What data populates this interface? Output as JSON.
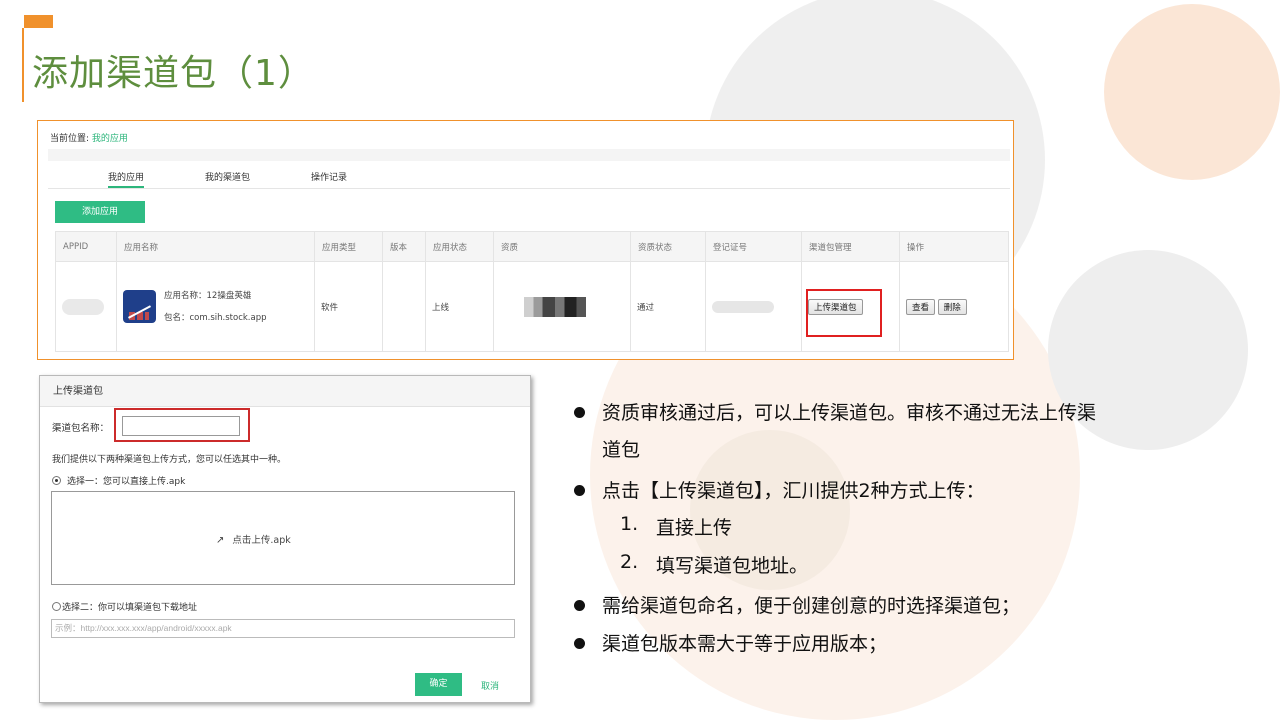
{
  "slide": {
    "title": "添加渠道包（1）",
    "accent_color": "#f0912c",
    "title_color": "#5e8e3e"
  },
  "top_screenshot": {
    "breadcrumb_label": "当前位置:",
    "breadcrumb_link": "我的应用",
    "tabs": [
      {
        "label": "我的应用",
        "active": true
      },
      {
        "label": "我的渠道包",
        "active": false
      },
      {
        "label": "操作记录",
        "active": false
      }
    ],
    "add_app_button": "添加应用",
    "columns": [
      "APPID",
      "应用名称",
      "应用类型",
      "版本",
      "应用状态",
      "资质",
      "资质状态",
      "登记证号",
      "渠道包管理",
      "操作"
    ],
    "row": {
      "app_name": "应用名称：12操盘英雄",
      "package": "包名：com.sih.stock.app",
      "type": "软件",
      "version": "",
      "status": "上线",
      "qualification_status": "通过",
      "upload_button": "上传渠道包",
      "view_button": "查看",
      "delete_button": "删除"
    },
    "brand_color": "#2fbc84",
    "highlight_color": "#e02020"
  },
  "dialog": {
    "title": "上传渠道包",
    "name_label": "渠道包名称：",
    "name_value": "",
    "intro": "我们提供以下两种渠道包上传方式，您可以任选其中一种。",
    "option1": "选择一：您可以直接上传.apk",
    "option1_selected": true,
    "upload_link": "点击上传.apk",
    "option2": "选择二：你可以填渠道包下载地址",
    "option2_selected": false,
    "url_placeholder": "示例：http://xxx.xxx.xxx/app/android/xxxxx.apk",
    "confirm_button": "确定",
    "cancel_link": "取消"
  },
  "bullets": {
    "b1_line1": "资质审核通过后，可以上传渠道包。审核不通过无法上传渠",
    "b1_line2": "道包",
    "b2": "点击【上传渠道包】，汇川提供2种方式上传：",
    "sub": [
      {
        "num": "1.",
        "text": "直接上传"
      },
      {
        "num": "2.",
        "text": "填写渠道包地址。"
      }
    ],
    "b3": "需给渠道包命名，便于创建创意的时选择渠道包；",
    "b4": "渠道包版本需大于等于应用版本；"
  }
}
